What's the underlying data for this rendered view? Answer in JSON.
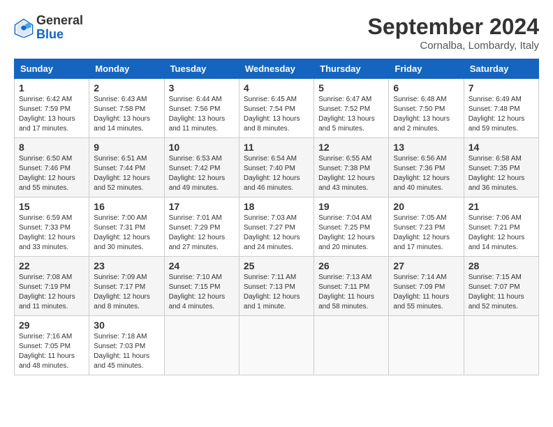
{
  "logo": {
    "general": "General",
    "blue": "Blue"
  },
  "title": "September 2024",
  "location": "Cornalba, Lombardy, Italy",
  "headers": [
    "Sunday",
    "Monday",
    "Tuesday",
    "Wednesday",
    "Thursday",
    "Friday",
    "Saturday"
  ],
  "weeks": [
    [
      {
        "day": "1",
        "info": "Sunrise: 6:42 AM\nSunset: 7:59 PM\nDaylight: 13 hours\nand 17 minutes."
      },
      {
        "day": "2",
        "info": "Sunrise: 6:43 AM\nSunset: 7:58 PM\nDaylight: 13 hours\nand 14 minutes."
      },
      {
        "day": "3",
        "info": "Sunrise: 6:44 AM\nSunset: 7:56 PM\nDaylight: 13 hours\nand 11 minutes."
      },
      {
        "day": "4",
        "info": "Sunrise: 6:45 AM\nSunset: 7:54 PM\nDaylight: 13 hours\nand 8 minutes."
      },
      {
        "day": "5",
        "info": "Sunrise: 6:47 AM\nSunset: 7:52 PM\nDaylight: 13 hours\nand 5 minutes."
      },
      {
        "day": "6",
        "info": "Sunrise: 6:48 AM\nSunset: 7:50 PM\nDaylight: 13 hours\nand 2 minutes."
      },
      {
        "day": "7",
        "info": "Sunrise: 6:49 AM\nSunset: 7:48 PM\nDaylight: 12 hours\nand 59 minutes."
      }
    ],
    [
      {
        "day": "8",
        "info": "Sunrise: 6:50 AM\nSunset: 7:46 PM\nDaylight: 12 hours\nand 55 minutes."
      },
      {
        "day": "9",
        "info": "Sunrise: 6:51 AM\nSunset: 7:44 PM\nDaylight: 12 hours\nand 52 minutes."
      },
      {
        "day": "10",
        "info": "Sunrise: 6:53 AM\nSunset: 7:42 PM\nDaylight: 12 hours\nand 49 minutes."
      },
      {
        "day": "11",
        "info": "Sunrise: 6:54 AM\nSunset: 7:40 PM\nDaylight: 12 hours\nand 46 minutes."
      },
      {
        "day": "12",
        "info": "Sunrise: 6:55 AM\nSunset: 7:38 PM\nDaylight: 12 hours\nand 43 minutes."
      },
      {
        "day": "13",
        "info": "Sunrise: 6:56 AM\nSunset: 7:36 PM\nDaylight: 12 hours\nand 40 minutes."
      },
      {
        "day": "14",
        "info": "Sunrise: 6:58 AM\nSunset: 7:35 PM\nDaylight: 12 hours\nand 36 minutes."
      }
    ],
    [
      {
        "day": "15",
        "info": "Sunrise: 6:59 AM\nSunset: 7:33 PM\nDaylight: 12 hours\nand 33 minutes."
      },
      {
        "day": "16",
        "info": "Sunrise: 7:00 AM\nSunset: 7:31 PM\nDaylight: 12 hours\nand 30 minutes."
      },
      {
        "day": "17",
        "info": "Sunrise: 7:01 AM\nSunset: 7:29 PM\nDaylight: 12 hours\nand 27 minutes."
      },
      {
        "day": "18",
        "info": "Sunrise: 7:03 AM\nSunset: 7:27 PM\nDaylight: 12 hours\nand 24 minutes."
      },
      {
        "day": "19",
        "info": "Sunrise: 7:04 AM\nSunset: 7:25 PM\nDaylight: 12 hours\nand 20 minutes."
      },
      {
        "day": "20",
        "info": "Sunrise: 7:05 AM\nSunset: 7:23 PM\nDaylight: 12 hours\nand 17 minutes."
      },
      {
        "day": "21",
        "info": "Sunrise: 7:06 AM\nSunset: 7:21 PM\nDaylight: 12 hours\nand 14 minutes."
      }
    ],
    [
      {
        "day": "22",
        "info": "Sunrise: 7:08 AM\nSunset: 7:19 PM\nDaylight: 12 hours\nand 11 minutes."
      },
      {
        "day": "23",
        "info": "Sunrise: 7:09 AM\nSunset: 7:17 PM\nDaylight: 12 hours\nand 8 minutes."
      },
      {
        "day": "24",
        "info": "Sunrise: 7:10 AM\nSunset: 7:15 PM\nDaylight: 12 hours\nand 4 minutes."
      },
      {
        "day": "25",
        "info": "Sunrise: 7:11 AM\nSunset: 7:13 PM\nDaylight: 12 hours\nand 1 minute."
      },
      {
        "day": "26",
        "info": "Sunrise: 7:13 AM\nSunset: 7:11 PM\nDaylight: 11 hours\nand 58 minutes."
      },
      {
        "day": "27",
        "info": "Sunrise: 7:14 AM\nSunset: 7:09 PM\nDaylight: 11 hours\nand 55 minutes."
      },
      {
        "day": "28",
        "info": "Sunrise: 7:15 AM\nSunset: 7:07 PM\nDaylight: 11 hours\nand 52 minutes."
      }
    ],
    [
      {
        "day": "29",
        "info": "Sunrise: 7:16 AM\nSunset: 7:05 PM\nDaylight: 11 hours\nand 48 minutes."
      },
      {
        "day": "30",
        "info": "Sunrise: 7:18 AM\nSunset: 7:03 PM\nDaylight: 11 hours\nand 45 minutes."
      },
      null,
      null,
      null,
      null,
      null
    ]
  ]
}
